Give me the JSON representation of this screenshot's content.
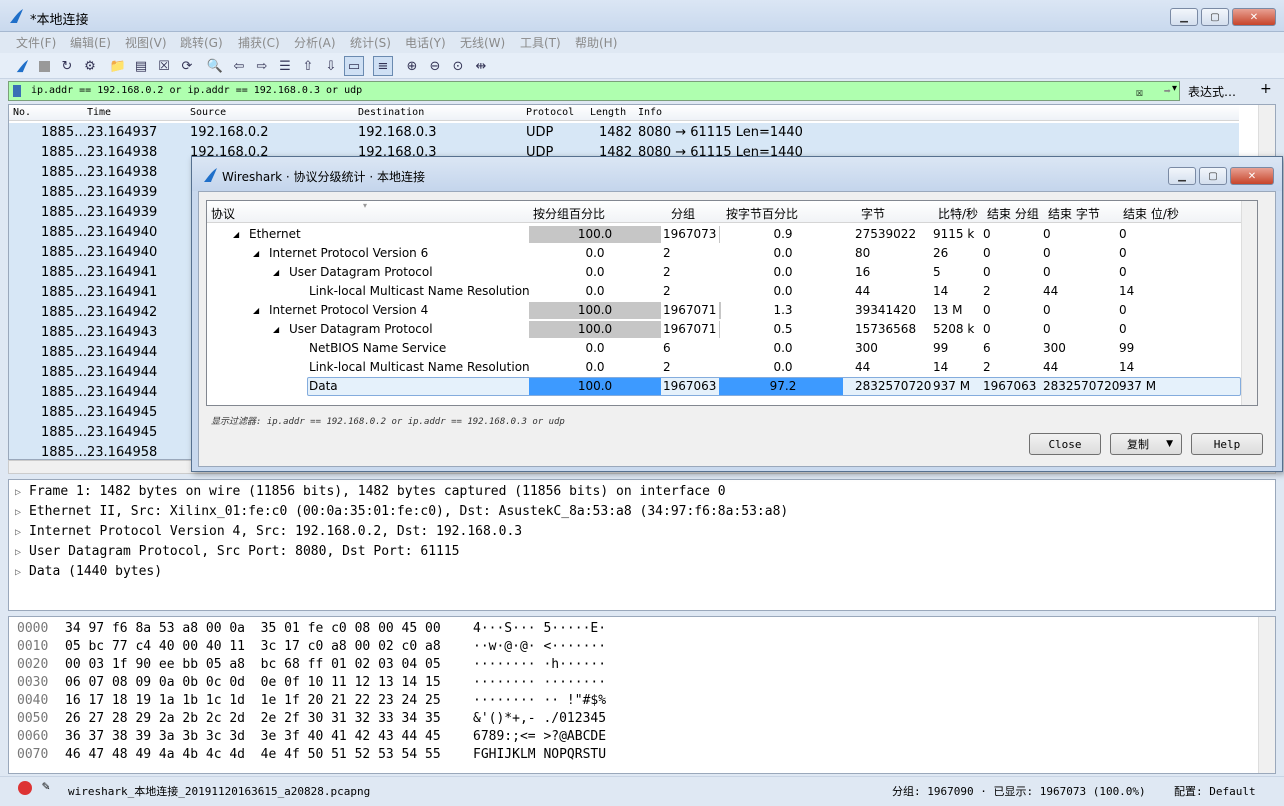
{
  "window": {
    "title": "*本地连接"
  },
  "menu": [
    "文件(F)",
    "编辑(E)",
    "视图(V)",
    "跳转(G)",
    "捕获(C)",
    "分析(A)",
    "统计(S)",
    "电话(Y)",
    "无线(W)",
    "工具(T)",
    "帮助(H)"
  ],
  "filter": {
    "value": "ip.addr == 192.168.0.2 or ip.addr == 192.168.0.3 or udp",
    "expression_label": "表达式…",
    "plus_label": "+"
  },
  "packet_list": {
    "headers": [
      "No.",
      "Time",
      "Source",
      "Destination",
      "Protocol",
      "Length",
      "Info"
    ],
    "rows": [
      [
        "1885…",
        "23.164937",
        "192.168.0.2",
        "192.168.0.3",
        "UDP",
        "1482",
        "8080 → 61115 Len=1440"
      ],
      [
        "1885…",
        "23.164938",
        "192.168.0.2",
        "192.168.0.3",
        "UDP",
        "1482",
        "8080 → 61115 Len=1440"
      ],
      [
        "1885…",
        "23.164938",
        "",
        "",
        "",
        "",
        ""
      ],
      [
        "1885…",
        "23.164939",
        "",
        "",
        "",
        "",
        ""
      ],
      [
        "1885…",
        "23.164939",
        "",
        "",
        "",
        "",
        ""
      ],
      [
        "1885…",
        "23.164940",
        "",
        "",
        "",
        "",
        ""
      ],
      [
        "1885…",
        "23.164940",
        "",
        "",
        "",
        "",
        ""
      ],
      [
        "1885…",
        "23.164941",
        "",
        "",
        "",
        "",
        ""
      ],
      [
        "1885…",
        "23.164941",
        "",
        "",
        "",
        "",
        ""
      ],
      [
        "1885…",
        "23.164942",
        "",
        "",
        "",
        "",
        ""
      ],
      [
        "1885…",
        "23.164943",
        "",
        "",
        "",
        "",
        ""
      ],
      [
        "1885…",
        "23.164944",
        "",
        "",
        "",
        "",
        ""
      ],
      [
        "1885…",
        "23.164944",
        "",
        "",
        "",
        "",
        ""
      ],
      [
        "1885…",
        "23.164944",
        "",
        "",
        "",
        "",
        ""
      ],
      [
        "1885…",
        "23.164945",
        "",
        "",
        "",
        "",
        ""
      ],
      [
        "1885…",
        "23.164945",
        "",
        "",
        "",
        "",
        ""
      ],
      [
        "1885…",
        "23.164958",
        "",
        "",
        "",
        "",
        ""
      ]
    ]
  },
  "details": [
    "Frame 1: 1482 bytes on wire (11856 bits), 1482 bytes captured (11856 bits) on interface 0",
    "Ethernet II, Src: Xilinx_01:fe:c0 (00:0a:35:01:fe:c0), Dst: AsustekC_8a:53:a8 (34:97:f6:8a:53:a8)",
    "Internet Protocol Version 4, Src: 192.168.0.2, Dst: 192.168.0.3",
    "User Datagram Protocol, Src Port: 8080, Dst Port: 61115",
    "Data (1440 bytes)"
  ],
  "hex": [
    {
      "off": "0000",
      "hex": "34 97 f6 8a 53 a8 00 0a  35 01 fe c0 08 00 45 00",
      "ascii": "4···S··· 5·····E·"
    },
    {
      "off": "0010",
      "hex": "05 bc 77 c4 40 00 40 11  3c 17 c0 a8 00 02 c0 a8",
      "ascii": "··w·@·@· <·······"
    },
    {
      "off": "0020",
      "hex": "00 03 1f 90 ee bb 05 a8  bc 68 ff 01 02 03 04 05",
      "ascii": "········ ·h······"
    },
    {
      "off": "0030",
      "hex": "06 07 08 09 0a 0b 0c 0d  0e 0f 10 11 12 13 14 15",
      "ascii": "········ ········"
    },
    {
      "off": "0040",
      "hex": "16 17 18 19 1a 1b 1c 1d  1e 1f 20 21 22 23 24 25",
      "ascii": "········ ·· !\"#$%"
    },
    {
      "off": "0050",
      "hex": "26 27 28 29 2a 2b 2c 2d  2e 2f 30 31 32 33 34 35",
      "ascii": "&'()*+,- ./012345"
    },
    {
      "off": "0060",
      "hex": "36 37 38 39 3a 3b 3c 3d  3e 3f 40 41 42 43 44 45",
      "ascii": "6789:;<= >?@ABCDE"
    },
    {
      "off": "0070",
      "hex": "46 47 48 49 4a 4b 4c 4d  4e 4f 50 51 52 53 54 55",
      "ascii": "FGHIJKLM NOPQRSTU"
    }
  ],
  "status": {
    "file": "wireshark_本地连接_20191120163615_a20828.pcapng",
    "packets": "分组: 1967090 · 已显示: 1967073 (100.0%)",
    "profile": "配置: Default"
  },
  "dialog": {
    "title": "Wireshark · 协议分级统计 · 本地连接",
    "headers": [
      "协议",
      "按分组百分比",
      "分组",
      "按字节百分比",
      "字节",
      "比特/秒",
      "结束 分组",
      "结束 字节",
      "结束 位/秒"
    ],
    "rows": [
      {
        "name": "Ethernet",
        "level": 0,
        "pkt_pct": "100.0",
        "packets": "1967073",
        "byte_pct": "0.9",
        "bytes": "27539022",
        "bps": "9115 k",
        "end_pkts": "0",
        "end_bytes": "0",
        "end_bps": "0",
        "pkt_pct_value": 100.0,
        "byte_pct_value": 0.9
      },
      {
        "name": "Internet Protocol Version 6",
        "level": 1,
        "pkt_pct": "0.0",
        "packets": "2",
        "byte_pct": "0.0",
        "bytes": "80",
        "bps": "26",
        "end_pkts": "0",
        "end_bytes": "0",
        "end_bps": "0",
        "pkt_pct_value": 0.0,
        "byte_pct_value": 0.0
      },
      {
        "name": "User Datagram Protocol",
        "level": 2,
        "pkt_pct": "0.0",
        "packets": "2",
        "byte_pct": "0.0",
        "bytes": "16",
        "bps": "5",
        "end_pkts": "0",
        "end_bytes": "0",
        "end_bps": "0",
        "pkt_pct_value": 0.0,
        "byte_pct_value": 0.0
      },
      {
        "name": "Link-local Multicast Name Resolution",
        "level": 3,
        "pkt_pct": "0.0",
        "packets": "2",
        "byte_pct": "0.0",
        "bytes": "44",
        "bps": "14",
        "end_pkts": "2",
        "end_bytes": "44",
        "end_bps": "14",
        "pkt_pct_value": 0.0,
        "byte_pct_value": 0.0
      },
      {
        "name": "Internet Protocol Version 4",
        "level": 1,
        "pkt_pct": "100.0",
        "packets": "1967071",
        "byte_pct": "1.3",
        "bytes": "39341420",
        "bps": "13 M",
        "end_pkts": "0",
        "end_bytes": "0",
        "end_bps": "0",
        "pkt_pct_value": 100.0,
        "byte_pct_value": 1.3
      },
      {
        "name": "User Datagram Protocol",
        "level": 2,
        "pkt_pct": "100.0",
        "packets": "1967071",
        "byte_pct": "0.5",
        "bytes": "15736568",
        "bps": "5208 k",
        "end_pkts": "0",
        "end_bytes": "0",
        "end_bps": "0",
        "pkt_pct_value": 100.0,
        "byte_pct_value": 0.5
      },
      {
        "name": "NetBIOS Name Service",
        "level": 3,
        "pkt_pct": "0.0",
        "packets": "6",
        "byte_pct": "0.0",
        "bytes": "300",
        "bps": "99",
        "end_pkts": "6",
        "end_bytes": "300",
        "end_bps": "99",
        "pkt_pct_value": 0.0,
        "byte_pct_value": 0.0
      },
      {
        "name": "Link-local Multicast Name Resolution",
        "level": 3,
        "pkt_pct": "0.0",
        "packets": "2",
        "byte_pct": "0.0",
        "bytes": "44",
        "bps": "14",
        "end_pkts": "2",
        "end_bytes": "44",
        "end_bps": "14",
        "pkt_pct_value": 0.0,
        "byte_pct_value": 0.0
      },
      {
        "name": "Data",
        "level": 3,
        "pkt_pct": "100.0",
        "packets": "1967063",
        "byte_pct": "97.2",
        "bytes": "2832570720",
        "bps": "937 M",
        "end_pkts": "1967063",
        "end_bytes": "2832570720",
        "end_bps": "937 M",
        "pkt_pct_value": 100.0,
        "byte_pct_value": 97.2,
        "selected": true
      }
    ],
    "display_filter": "显示过滤器: ip.addr == 192.168.0.2 or ip.addr == 192.168.0.3 or udp",
    "close_label": "Close",
    "copy_label": "复制",
    "help_label": "Help"
  },
  "colors": {
    "filter_bg": "#afffaf",
    "row_bg": "#d7e7f6",
    "bar_gray": "#c6c6c6",
    "bar_blue": "#3d9aff"
  }
}
